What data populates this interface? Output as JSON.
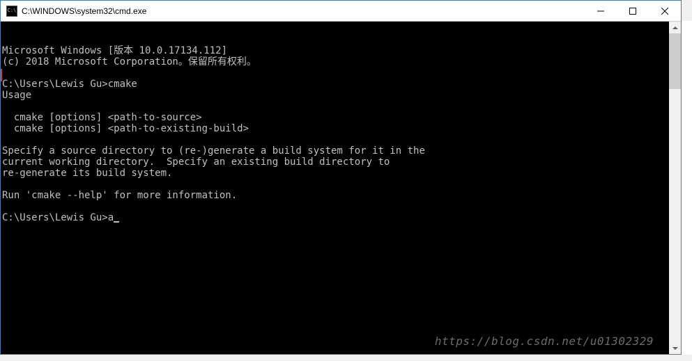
{
  "titlebar": {
    "icon_label": "C:\\",
    "title": "C:\\WINDOWS\\system32\\cmd.exe"
  },
  "terminal": {
    "header1": "Microsoft Windows [版本 10.0.17134.112]",
    "header2": "(c) 2018 Microsoft Corporation。保留所有权利。",
    "prompt1": "C:\\Users\\Lewis Gu>cmake",
    "usage_title": "Usage",
    "usage_line1": "  cmake [options] <path-to-source>",
    "usage_line2": "  cmake [options] <path-to-existing-build>",
    "desc_line1": "Specify a source directory to (re-)generate a build system for it in the",
    "desc_line2": "current working directory.  Specify an existing build directory to",
    "desc_line3": "re-generate its build system.",
    "help_line": "Run 'cmake --help' for more information.",
    "prompt2_prefix": "C:\\Users\\Lewis Gu>",
    "prompt2_input": "a"
  },
  "watermark": "https://blog.csdn.net/u01302329"
}
